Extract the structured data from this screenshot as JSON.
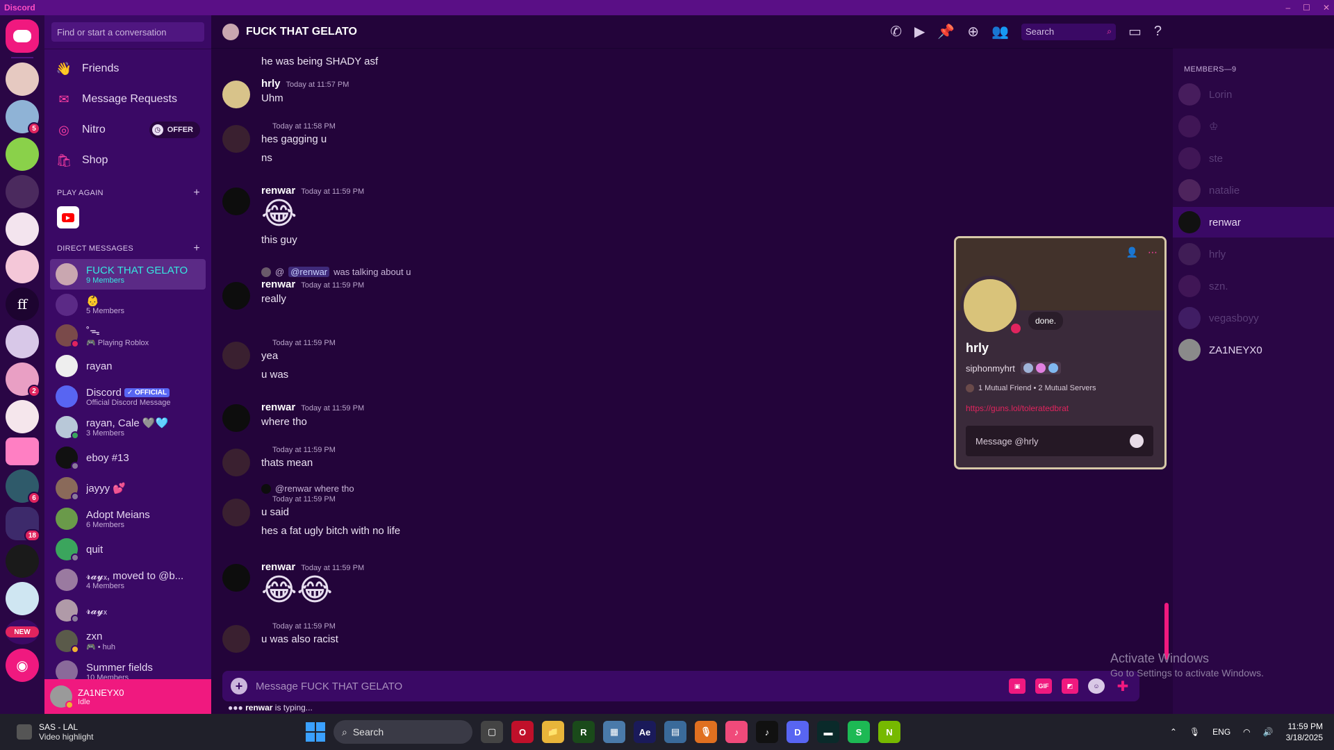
{
  "window": {
    "title": "Discord",
    "controls": [
      "–",
      "☐",
      "✕"
    ]
  },
  "servers": [
    {
      "color": "#f0197f",
      "badge": ""
    },
    {
      "color": "#e6c9c1",
      "badge": ""
    },
    {
      "color": "#8fb3d6",
      "badge": "5"
    },
    {
      "color": "#8ad14a",
      "badge": ""
    },
    {
      "color": "#4b2a5e",
      "badge": ""
    },
    {
      "color": "#f3e4ee",
      "badge": ""
    },
    {
      "color": "#f4c7d8",
      "badge": ""
    },
    {
      "color": "#d8c8e8",
      "badge": ""
    },
    {
      "color": "#e99fc4",
      "badge": "2"
    },
    {
      "color": "#f5e6ec",
      "badge": ""
    },
    {
      "color": "#ff7fc3",
      "badge": ""
    },
    {
      "color": "#2f5a6a",
      "badge": "6"
    },
    {
      "color": "#3d2a6b",
      "badge": "18"
    },
    {
      "color": "#1a1a1a",
      "badge": ""
    },
    {
      "color": "#cfe6f2",
      "badge": ""
    }
  ],
  "server_text_icon": "ff",
  "server_new_label": "NEW",
  "dm_sidebar": {
    "search_placeholder": "Find or start a conversation",
    "nav": [
      {
        "label": "Friends",
        "icon": "👋"
      },
      {
        "label": "Message Requests",
        "icon": "✉"
      },
      {
        "label": "Nitro",
        "icon": "◎"
      },
      {
        "label": "Shop",
        "icon": "🛍"
      }
    ],
    "offer_label": "OFFER",
    "play_again_title": "PLAY AGAIN",
    "direct_messages_title": "DIRECT MESSAGES",
    "dms": [
      {
        "name": "FUCK THAT GELATO",
        "sub": "9 Members",
        "color": "#c9a7b0",
        "status": "",
        "active": true
      },
      {
        "name": "👶",
        "sub": "5 Members",
        "color": "#5b2a86",
        "status": "",
        "active": false
      },
      {
        "name": "˚ᯓ",
        "sub": "🎮 Playing Roblox",
        "color": "#7a4a4a",
        "status": "#e0245e",
        "active": false
      },
      {
        "name": "rayan",
        "sub": "",
        "color": "#eeeeee",
        "status": "",
        "active": false
      },
      {
        "name": "Discord",
        "sub": "Official Discord Message",
        "color": "#5865f2",
        "status": "",
        "active": false,
        "official": "✓ OFFICIAL"
      },
      {
        "name": "rayan, Cale 🩶🩵",
        "sub": "3 Members",
        "color": "#b8c8d8",
        "status": "#3ba55d",
        "active": false
      },
      {
        "name": "eboy #13",
        "sub": "",
        "color": "#111111",
        "status": "#8a7a9a",
        "active": false
      },
      {
        "name": "jayyy 💕",
        "sub": "",
        "color": "#8a6a5a",
        "status": "#8a7a9a",
        "active": false
      },
      {
        "name": "Adopt Meians",
        "sub": "6 Members",
        "color": "#6a9a4a",
        "status": "",
        "active": false
      },
      {
        "name": "quit",
        "sub": "",
        "color": "#3ba55d",
        "status": "#8a7a9a",
        "active": false
      },
      {
        "name": "𝓻𝓪𝔂ₓ, moved to @b...",
        "sub": "4 Members",
        "color": "#9a7aa0",
        "status": "",
        "active": false
      },
      {
        "name": "𝓻𝓪𝔂ₓ",
        "sub": "",
        "color": "#b09aa8",
        "status": "#8a7a9a",
        "active": false
      },
      {
        "name": "zxn",
        "sub": "🎮 • huh",
        "color": "#5a5a4a",
        "status": "#f0b232",
        "active": false
      },
      {
        "name": "Summer fields",
        "sub": "10 Members",
        "color": "#8a6a9a",
        "status": "",
        "active": false
      }
    ],
    "user": {
      "name": "ZA1NEYX0",
      "status": "Idle"
    }
  },
  "chat": {
    "title": "FUCK THAT GELATO",
    "search_placeholder": "Search",
    "composer_placeholder": "Message FUCK THAT GELATO",
    "gif_label": "GIF",
    "typing_user": "renwar",
    "typing_suffix": " is typing...",
    "messages": {
      "m0_line": "he was being SHADY asf",
      "m1_author": "hrly",
      "m1_time": "Today at 11:57 PM",
      "m1_line": "Uhm",
      "m2_time": "Today at 11:58 PM",
      "m2_line1": "hes gagging u",
      "m2_line2": "ns",
      "m3_author": "renwar",
      "m3_time": "Today at 11:59 PM",
      "m3_emoji": "😂",
      "m3_line": "this guy",
      "m4_reply_prefix": "@",
      "m4_reply_mention": "@renwar",
      "m4_reply_text": "was talking about u",
      "m4_author": "renwar",
      "m4_time": "Today at 11:59 PM",
      "m4_line": "really",
      "m5_time": "Today at 11:59 PM",
      "m5_line1": "yea",
      "m5_line2": "u was",
      "m6_author": "renwar",
      "m6_time": "Today at 11:59 PM",
      "m6_line": "where tho",
      "m7_time": "Today at 11:59 PM",
      "m7_line": "thats mean",
      "m8_reply": "@renwar where tho",
      "m8_time": "Today at 11:59 PM",
      "m8_line1": "u said",
      "m8_line2": "hes a fat ugly bitch with no life",
      "m9_author": "renwar",
      "m9_time": "Today at 11:59 PM",
      "m9_emoji": "😂😂",
      "m10_time": "Today at 11:59 PM",
      "m10_line": "u was also racist"
    }
  },
  "members": {
    "title": "MEMBERS—9",
    "list": [
      {
        "name": "Lorin",
        "color": "#6a3a7a",
        "active": false
      },
      {
        "name": "♔",
        "color": "#5a2a6a",
        "active": false
      },
      {
        "name": "ste",
        "color": "#5a2a6a",
        "active": false
      },
      {
        "name": "natalie",
        "color": "#7a4a7a",
        "active": false
      },
      {
        "name": "renwar",
        "color": "#111111",
        "active": true
      },
      {
        "name": "hrly",
        "color": "#5a3a6a",
        "active": false
      },
      {
        "name": "szn.",
        "color": "#5a2a6a",
        "active": false
      },
      {
        "name": "vegasboyy",
        "color": "#5a3a8a",
        "active": false
      },
      {
        "name": "ZA1NEYX0",
        "color": "#8a8a8a",
        "active": false,
        "online": true
      }
    ]
  },
  "popout": {
    "name": "hrly",
    "username": "siphonmyhrt",
    "status_bubble": "done.",
    "mutual": "1 Mutual Friend • 2 Mutual Servers",
    "link": "https://guns.lol/toleratedbrat",
    "message_placeholder": "Message @hrly"
  },
  "activate_windows": {
    "line1": "Activate Windows",
    "line2": "Go to Settings to activate Windows."
  },
  "taskbar": {
    "widget_title": "SAS - LAL",
    "widget_sub": "Video highlight",
    "search_label": "Search",
    "language": "ENG",
    "time": "11:59 PM",
    "date": "3/18/2025",
    "apps": [
      {
        "label": "▢",
        "color": "#444"
      },
      {
        "label": "O",
        "color": "#c0102a"
      },
      {
        "label": "📁",
        "color": "#e8b53a"
      },
      {
        "label": "R",
        "color": "#1a4a1a"
      },
      {
        "label": "▦",
        "color": "#4a7aaa"
      },
      {
        "label": "Ae",
        "color": "#1a1a5a"
      },
      {
        "label": "▤",
        "color": "#3a6a9a"
      },
      {
        "label": "🎙",
        "color": "#e07020"
      },
      {
        "label": "♪",
        "color": "#f04a7a"
      },
      {
        "label": "♪",
        "color": "#111"
      },
      {
        "label": "D",
        "color": "#5865f2"
      },
      {
        "label": "▬",
        "color": "#0a2a2a"
      },
      {
        "label": "S",
        "color": "#1db954"
      },
      {
        "label": "N",
        "color": "#76b900"
      }
    ]
  }
}
